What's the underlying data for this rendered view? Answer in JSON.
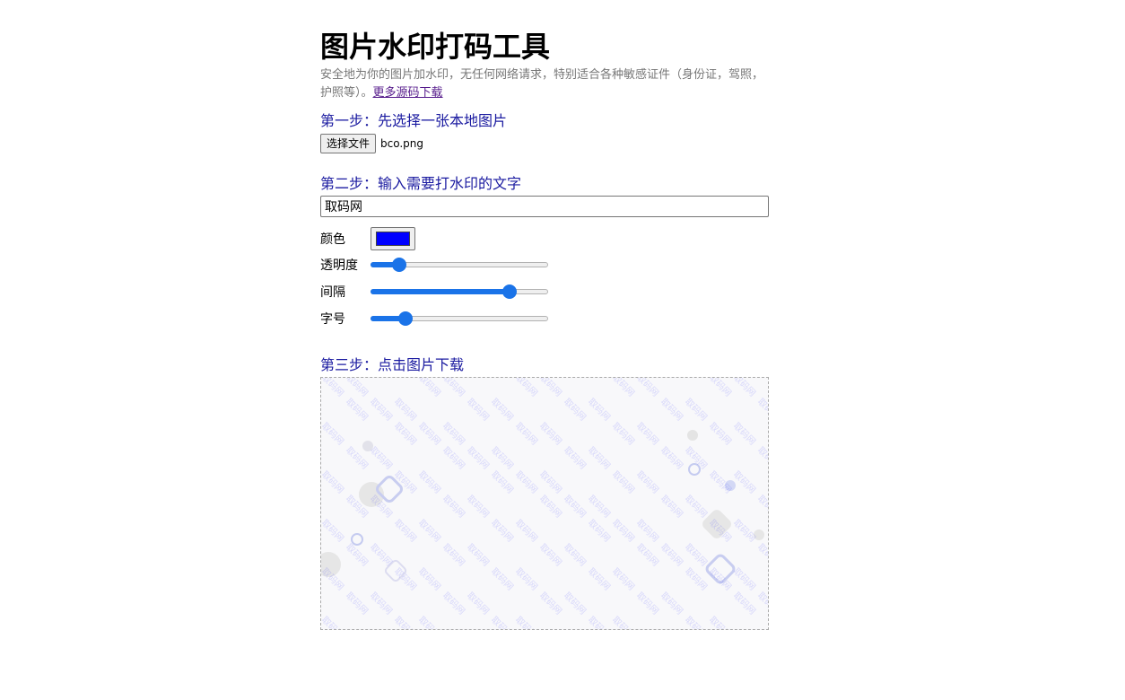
{
  "header": {
    "title": "图片水印打码工具",
    "description": "安全地为你的图片加水印，无任何网络请求，特别适合各种敏感证件（身份证，驾照，护照等）。",
    "link_label": "更多源码下载"
  },
  "step1": {
    "label": "第一步：先选择一张本地图片",
    "button_label": "选择文件",
    "file_name": "bco.png"
  },
  "step2": {
    "label": "第二步：输入需要打水印的文字",
    "watermark_text": "取码网",
    "color_label": "颜色",
    "color_value": "#0000ff",
    "opacity_label": "透明度",
    "opacity_value": 0.13,
    "spacing_label": "间隔",
    "spacing_value": 0.81,
    "font_size_label": "字号",
    "font_size_value": 0.17
  },
  "step3": {
    "label": "第三步：点击图片下载"
  }
}
